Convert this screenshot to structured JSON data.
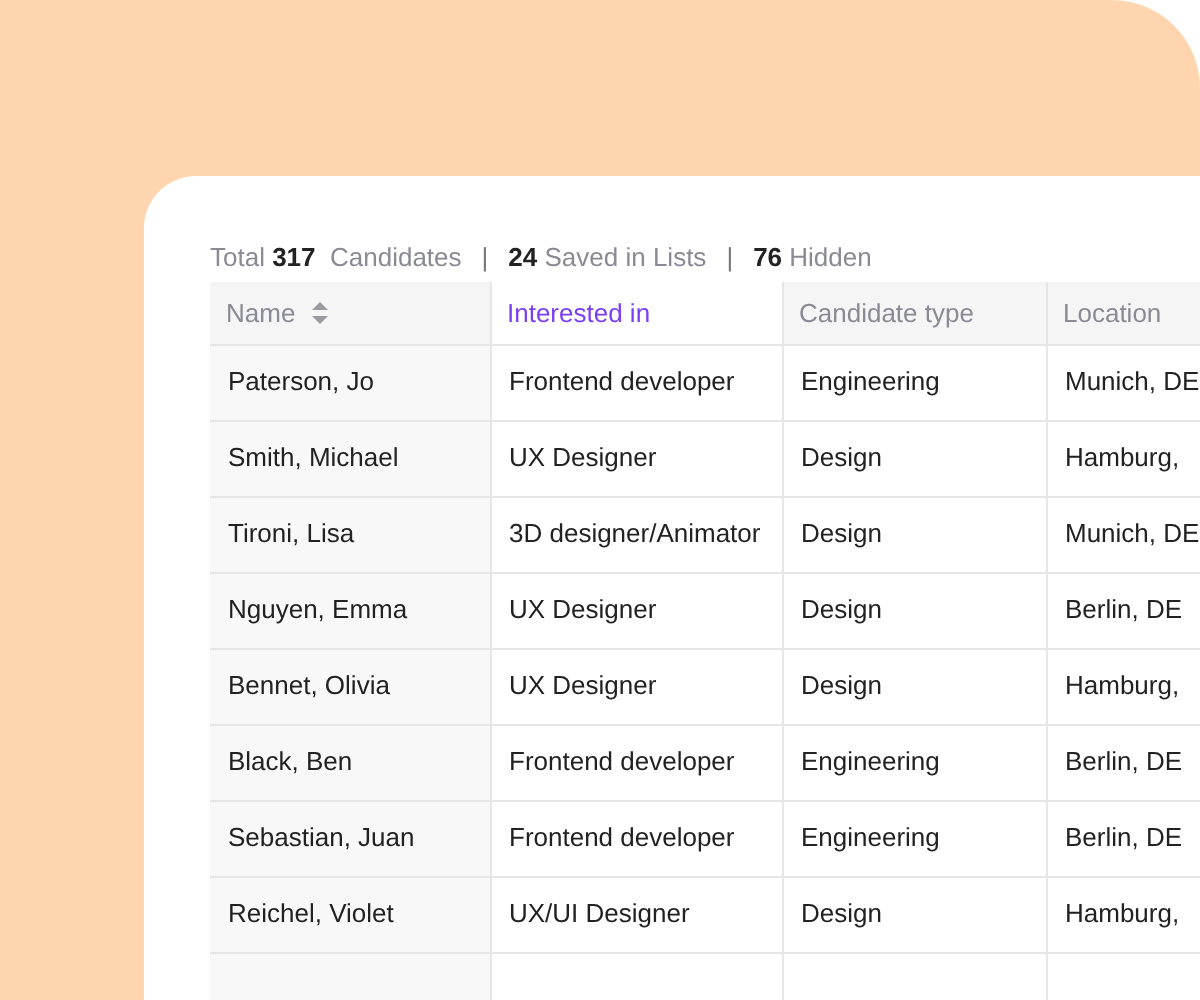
{
  "summary": [
    "Total **317**  Candidates",
    "**24** Saved in Lists",
    "**76** Hidden"
  ],
  "summary_separator": "|",
  "table": {
    "columns": [
      {
        "label": "Name",
        "sortable": true,
        "selected": false
      },
      {
        "label": "Interested in",
        "sortable": false,
        "selected": true
      },
      {
        "label": "Candidate type",
        "sortable": false,
        "selected": false
      },
      {
        "label": "Location",
        "sortable": false,
        "selected": false
      }
    ],
    "rows": [
      [
        "Paterson, Jo",
        "Frontend developer",
        "Engineering",
        "Munich, DE"
      ],
      [
        "Smith, Michael",
        "UX Designer",
        "Design",
        "Hamburg,"
      ],
      [
        "Tironi, Lisa",
        "3D designer/Animator",
        "Design",
        "Munich, DE"
      ],
      [
        "Nguyen, Emma",
        "UX Designer",
        "Design",
        "Berlin, DE"
      ],
      [
        "Bennet, Olivia",
        "UX Designer",
        "Design",
        "Hamburg,"
      ],
      [
        "Black, Ben",
        "Frontend developer",
        "Engineering",
        "Berlin, DE"
      ],
      [
        "Sebastian, Juan",
        "Frontend developer",
        "Engineering",
        "Berlin, DE"
      ],
      [
        "Reichel, Violet",
        "UX/UI Designer",
        "Design",
        "Hamburg,"
      ]
    ]
  }
}
